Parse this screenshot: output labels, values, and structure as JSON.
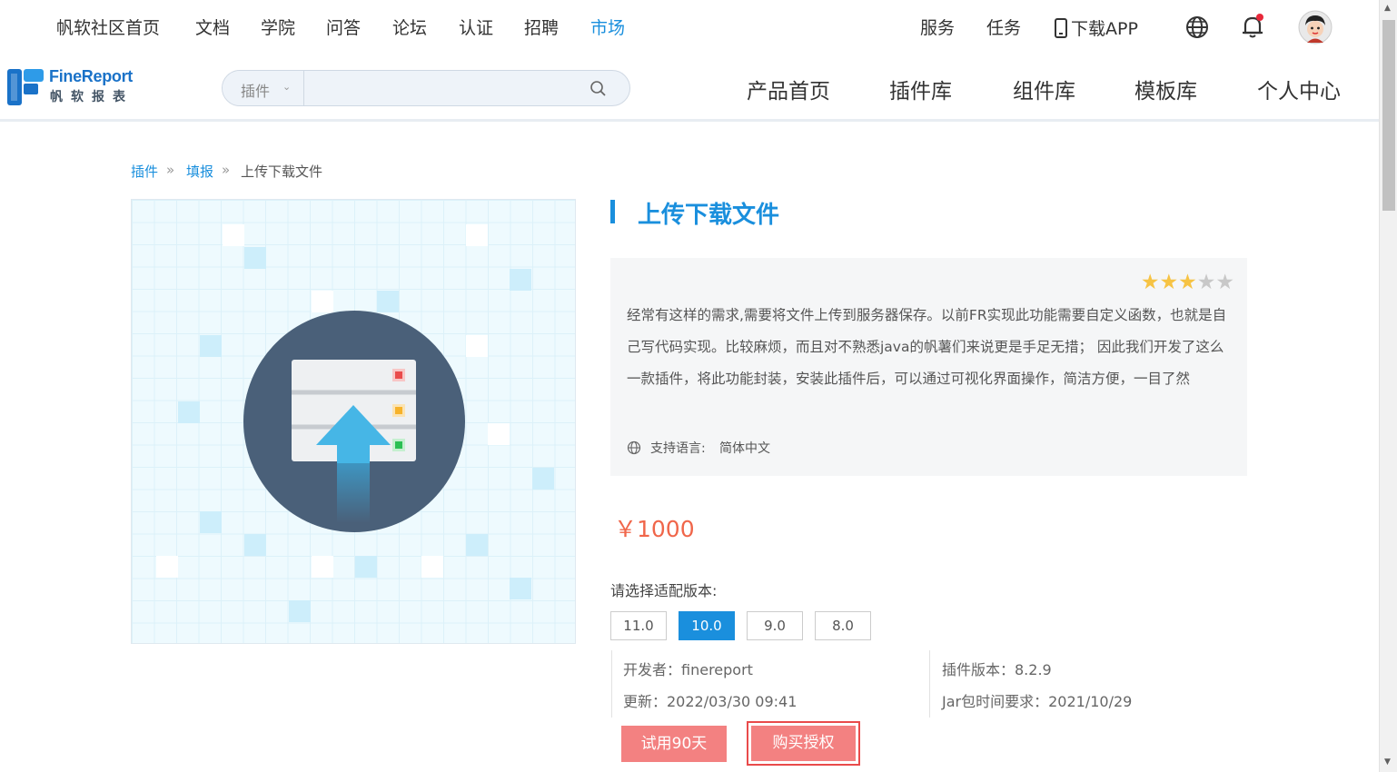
{
  "top_nav": {
    "left_items": [
      "帆软社区首页",
      "文档",
      "学院",
      "问答",
      "论坛",
      "认证",
      "招聘",
      "市场"
    ],
    "active_item": "市场",
    "right_items": {
      "service": "服务",
      "tasks": "任务",
      "download_app": "下载APP"
    },
    "icons": {
      "globe": "globe-icon",
      "bell": "bell-icon",
      "avatar": "avatar",
      "phone": "phone-icon"
    }
  },
  "header": {
    "logo": {
      "brand": "FineReport",
      "subtitle": "帆软报表"
    },
    "search": {
      "scope": "插件",
      "placeholder": ""
    },
    "nav": [
      "产品首页",
      "插件库",
      "组件库",
      "模板库",
      "个人中心"
    ]
  },
  "breadcrumb": {
    "items": [
      "插件",
      "填报",
      "上传下载文件"
    ],
    "separator": "»"
  },
  "plugin": {
    "title": "上传下载文件",
    "rating": 3,
    "rating_max": 5,
    "description": "经常有这样的需求,需要将文件上传到服务器保存。以前FR实现此功能需要自定义函数，也就是自己写代码实现。比较麻烦，而且对不熟悉java的帆薯们来说更是手足无措； 因此我们开发了这么一款插件，将此功能封装，安装此插件后，可以通过可视化界面操作，简洁方便，一目了然",
    "language_label": "支持语言:",
    "language_value": "简体中文",
    "price": "￥1000",
    "version_label": "请选择适配版本:",
    "versions": [
      "11.0",
      "10.0",
      "9.0",
      "8.0"
    ],
    "selected_version": "10.0",
    "meta": {
      "developer": "开发者：finereport",
      "updated": "更新：2022/03/30 09:41",
      "plugin_version": "插件版本：8.2.9",
      "jar_requirement": "Jar包时间要求：2021/10/29"
    },
    "buttons": {
      "trial": "试用90天",
      "buy": "购买授权"
    }
  },
  "colors": {
    "accent": "#1a8fdd",
    "price": "#f0664a",
    "button": "#f38181",
    "star_on": "#f6c344",
    "star_off": "#c8c8c8"
  }
}
